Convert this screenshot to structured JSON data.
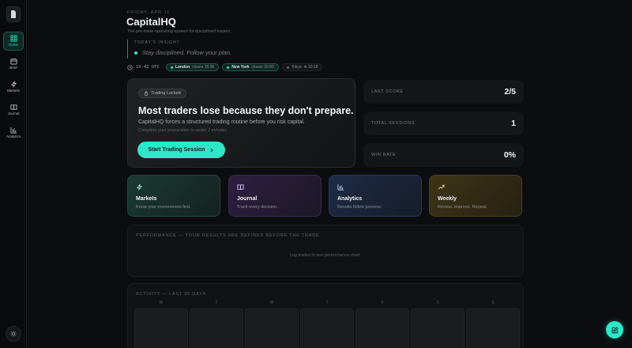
{
  "app": {
    "date": "FRIDAY, APR 11",
    "title": "CapitalHQ",
    "subtitle": "The pre-trade operating system for disciplined traders."
  },
  "sidebar": {
    "items": [
      {
        "label": "Home",
        "icon": "grid-icon"
      },
      {
        "label": "Brief",
        "icon": "calendar-icon"
      },
      {
        "label": "Markets",
        "icon": "bolt-icon"
      },
      {
        "label": "Journal",
        "icon": "book-icon"
      },
      {
        "label": "Analytics",
        "icon": "bar-chart-icon"
      }
    ],
    "settings_icon": "sun-icon"
  },
  "insight": {
    "label": "TODAY'S INSIGHT",
    "text": "Stay disciplined. Follow your plan."
  },
  "sessions": {
    "utc_time": "13:42 UTC",
    "markets": [
      {
        "name": "London",
        "status": "closes 16:30",
        "open": true
      },
      {
        "name": "New York",
        "status": "closes 20:00",
        "open": true
      },
      {
        "name": "Tokyo",
        "status": "in 10:18",
        "open": false
      }
    ]
  },
  "hero": {
    "badge": "Trading Locked",
    "headline": "Most traders lose because they don't prepare.",
    "sub": "CapitalHQ forces a structured trading routine before you risk capital.",
    "note": "Complete your preparation in under 2 minutes.",
    "cta": "Start Trading Session"
  },
  "stats": [
    {
      "label": "LAST SCORE",
      "value": "2/5"
    },
    {
      "label": "TOTAL SESSIONS",
      "value": "1"
    },
    {
      "label": "WIN RATE",
      "value": "0%"
    }
  ],
  "features": [
    {
      "title": "Markets",
      "desc": "Know your environment first."
    },
    {
      "title": "Journal",
      "desc": "Track every decision."
    },
    {
      "title": "Analytics",
      "desc": "Results follow process."
    },
    {
      "title": "Weekly",
      "desc": "Review. Improve. Repeat."
    }
  ],
  "performance": {
    "title": "PERFORMANCE — YOUR RESULTS ARE DEFINED BEFORE THE TRADE",
    "empty": "Log trades to see performance chart."
  },
  "activity": {
    "title": "ACTIVITY — LAST 35 DAYS",
    "days": [
      "M",
      "T",
      "W",
      "T",
      "F",
      "S",
      "S"
    ]
  },
  "colors": {
    "accent": "#2ee6c8",
    "background": "#0c0d0f"
  }
}
